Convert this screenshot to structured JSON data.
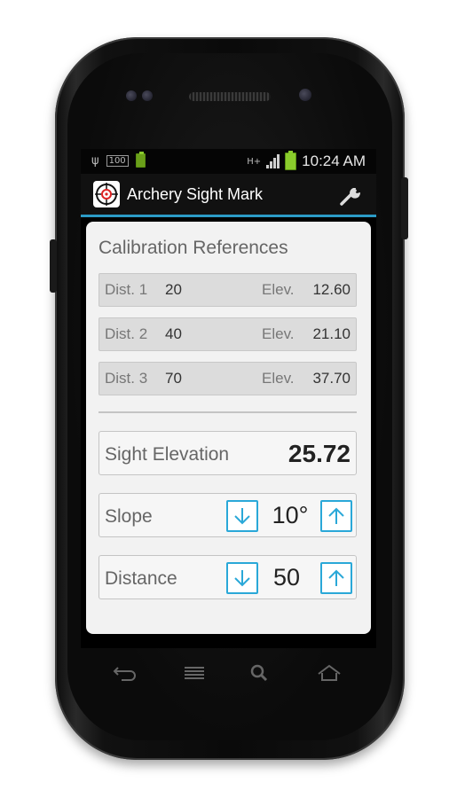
{
  "status": {
    "usb": "ψ",
    "battery_text": "100",
    "signal": "H+",
    "time": "10:24 AM"
  },
  "app": {
    "title": "Archery Sight Mark"
  },
  "calibration": {
    "heading": "Calibration References",
    "rows": [
      {
        "dist_label": "Dist. 1",
        "dist": "20",
        "elev_label": "Elev.",
        "elev": "12.60"
      },
      {
        "dist_label": "Dist. 2",
        "dist": "40",
        "elev_label": "Elev.",
        "elev": "21.10"
      },
      {
        "dist_label": "Dist. 3",
        "dist": "70",
        "elev_label": "Elev.",
        "elev": "37.70"
      }
    ]
  },
  "sight": {
    "label": "Sight Elevation",
    "value": "25.72"
  },
  "slope": {
    "label": "Slope",
    "value": "10°"
  },
  "distance": {
    "label": "Distance",
    "value": "50"
  },
  "colors": {
    "accent": "#2aa8d8",
    "titlebar_underline": "#2b9bc6",
    "battery": "#8acc2c"
  }
}
